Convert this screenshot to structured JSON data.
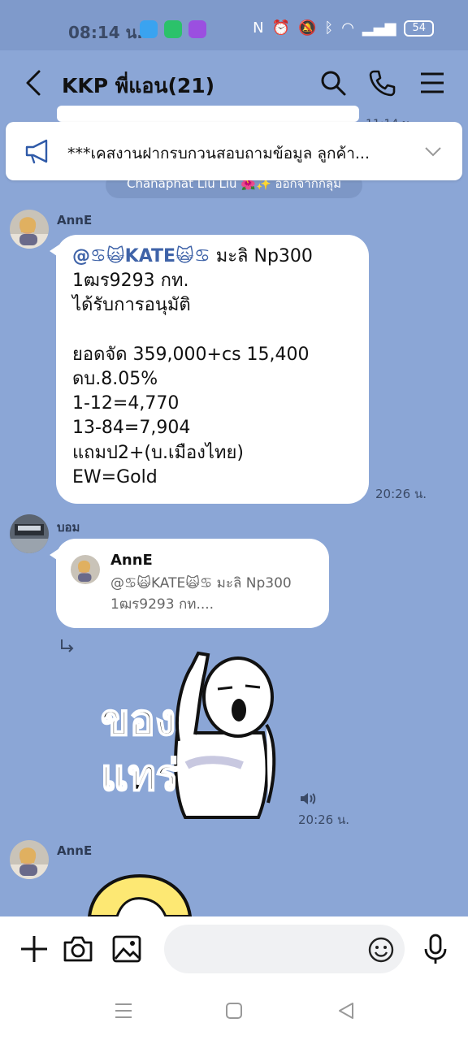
{
  "status_bar": {
    "time": "08:14 น.",
    "battery": "54"
  },
  "header": {
    "chat_title": "KKP พี่แอน(21)"
  },
  "announcement": {
    "text": "***เคสงานฝากรบกวนสอบถามข้อมูล ลูกค้า..."
  },
  "previous": {
    "time": "11:14 น."
  },
  "system_message": "Chanaphat Liu Liu 🌺✨ ออกจากกลุ่ม",
  "messages": [
    {
      "sender": "AnnE",
      "mention": "@♋🙀KATE🙀♋",
      "lines": [
        "มะลิ Np300",
        "1ฒร9293 กท.",
        "ได้รับการอนุมัติ",
        "",
        "ยอดจัด 359,000+cs 15,400",
        "ดบ.8.05%",
        "1-12=4,770",
        "13-84=7,904",
        "แถมป2+(บ.เมืองไทย)",
        "EW=Gold"
      ],
      "time": "20:26 น."
    },
    {
      "sender": "บอม",
      "quote_name": "AnnE",
      "quote_text": "@♋🙀KATE🙀♋ มะลิ Np300 1ฒร9293 กท....",
      "sticker_text_line1": "ของ",
      "sticker_text_line2": "แทร่",
      "time": "20:26 น."
    },
    {
      "sender": "AnnE"
    }
  ],
  "input": {
    "placeholder": ""
  },
  "colors": {
    "chat_background": "#8ba6d6",
    "bubble": "#ffffff",
    "mention": "#3f63a8",
    "status_bar": "#7f9acb"
  },
  "icons": [
    "back-icon",
    "search-icon",
    "phone-icon",
    "menu-icon",
    "megaphone-icon",
    "chevron-down-icon",
    "reply-arrow-icon",
    "sound-icon",
    "plus-icon",
    "camera-icon",
    "image-icon",
    "emoji-icon",
    "mic-icon",
    "nav-menu-icon",
    "nav-home-icon",
    "nav-back-icon"
  ]
}
